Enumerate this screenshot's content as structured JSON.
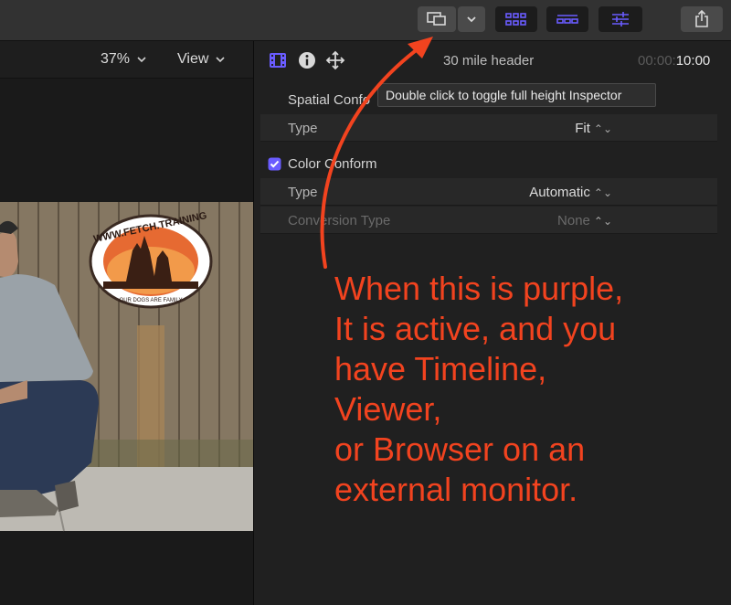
{
  "toolbar": {
    "buttons": [
      {
        "name": "external-monitor-button",
        "icon": "monitor-icon"
      },
      {
        "name": "external-monitor-menu",
        "icon": "chevron-down-icon"
      },
      {
        "name": "browser-toggle",
        "icon": "grid-icon",
        "active": true
      },
      {
        "name": "timeline-toggle",
        "icon": "timeline-icon",
        "active": true
      },
      {
        "name": "inspector-toggle",
        "icon": "sliders-icon",
        "active": true
      },
      {
        "name": "share-button",
        "icon": "share-icon"
      }
    ],
    "active_color": "#6a5cff"
  },
  "viewer": {
    "zoom": "37%",
    "view_label": "View",
    "logo_text_top": "WWW.FETCH.TRAINING",
    "logo_text_bottom": "OUR DOGS ARE FAMILY"
  },
  "inspector": {
    "clip_name": "30 mile header",
    "timecode_prefix": "00:00:",
    "timecode_value": "10:00",
    "spatial_conform": "Spatial Confo",
    "rows": {
      "spatial_type": {
        "label": "Type",
        "value": "Fit"
      },
      "color_type": {
        "label": "Type",
        "value": "Automatic"
      },
      "conversion_type": {
        "label": "Conversion Type",
        "value": "None"
      }
    },
    "color_conform": "Color Conform"
  },
  "tooltip": "Double click to toggle full height Inspector",
  "annotation": {
    "color": "#f2431f",
    "lines": [
      "When this is purple,",
      "It is active, and you",
      "have Timeline,",
      "Viewer,",
      "or Browser on an",
      "external monitor."
    ]
  }
}
